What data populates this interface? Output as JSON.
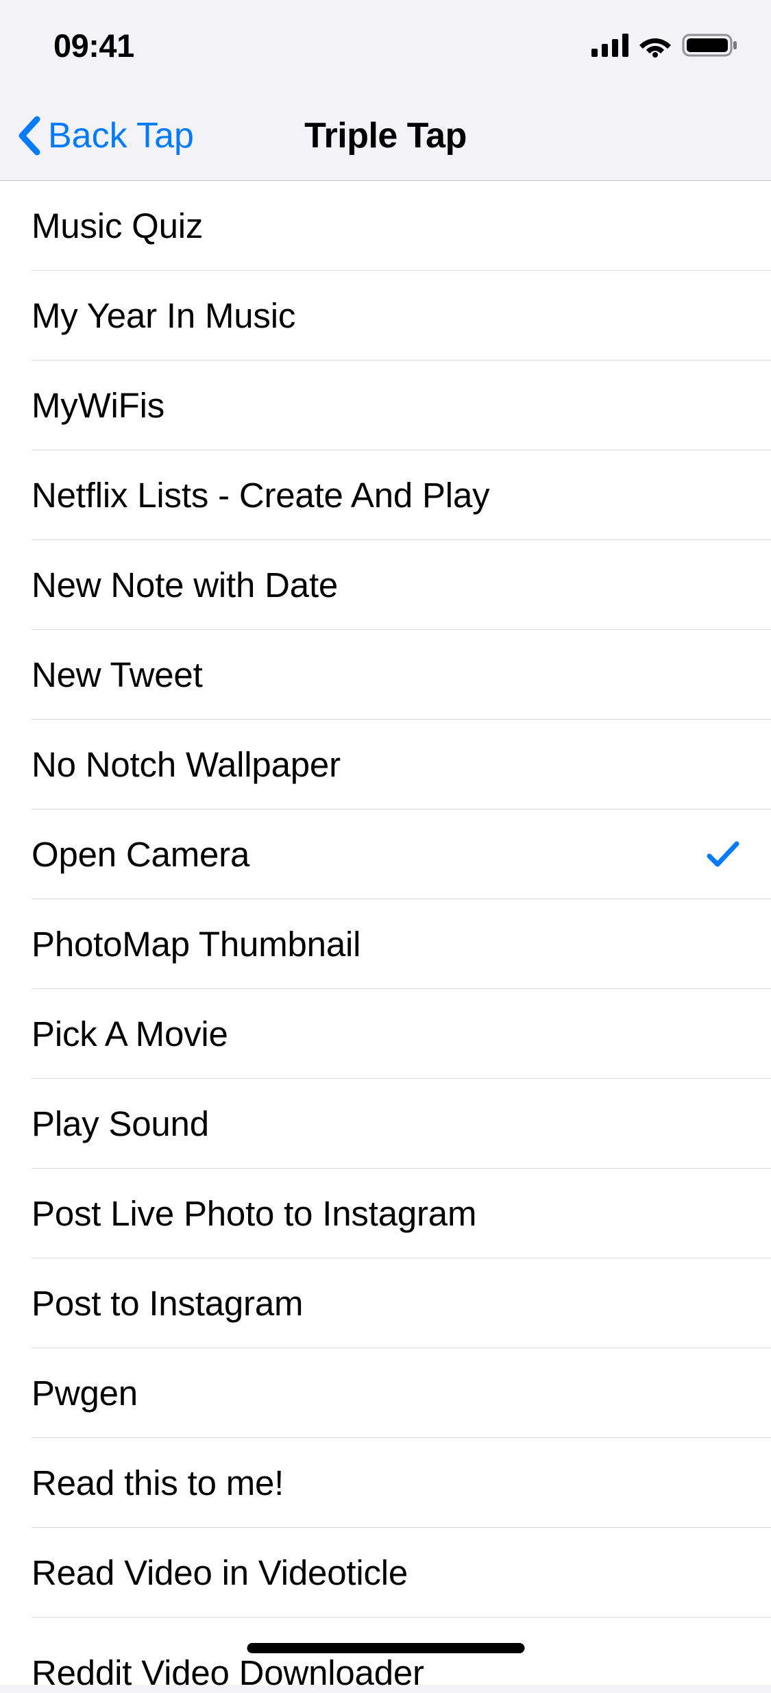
{
  "status": {
    "time": "09:41"
  },
  "nav": {
    "back_label": "Back Tap",
    "title": "Triple Tap"
  },
  "list": {
    "items": [
      {
        "label": "Music Quiz",
        "selected": false
      },
      {
        "label": "My Year In Music",
        "selected": false
      },
      {
        "label": "MyWiFis",
        "selected": false
      },
      {
        "label": "Netflix Lists - Create And Play",
        "selected": false
      },
      {
        "label": "New Note with Date",
        "selected": false
      },
      {
        "label": "New Tweet",
        "selected": false
      },
      {
        "label": "No Notch Wallpaper",
        "selected": false
      },
      {
        "label": "Open Camera",
        "selected": true
      },
      {
        "label": "PhotoMap Thumbnail",
        "selected": false
      },
      {
        "label": "Pick A Movie",
        "selected": false
      },
      {
        "label": "Play Sound",
        "selected": false
      },
      {
        "label": "Post Live Photo to Instagram",
        "selected": false
      },
      {
        "label": "Post to Instagram",
        "selected": false
      },
      {
        "label": "Pwgen",
        "selected": false
      },
      {
        "label": "Read this to me!",
        "selected": false
      },
      {
        "label": "Read Video in Videoticle",
        "selected": false
      }
    ],
    "partial_item": {
      "label": "Reddit Video Downloader"
    }
  }
}
